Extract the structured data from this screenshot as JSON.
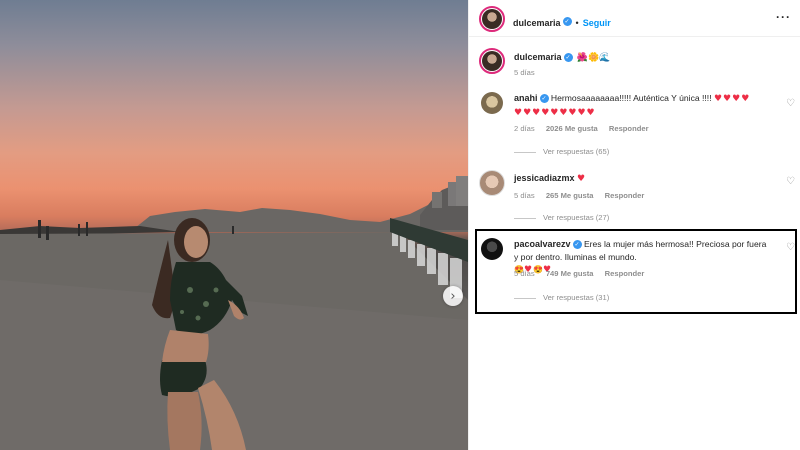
{
  "post": {
    "author": "dulcemaria",
    "follow_label": "Seguir",
    "more_icon": "more-horizontal-icon",
    "caption": "🌺🌼🌊",
    "caption_time": "5 días"
  },
  "comments": [
    {
      "user": "anahi",
      "text_prefix": "Hermosaaaaaaaa!!!!! Auténtica Y única !!!! ",
      "hearts_line1": "♥♥♥♥",
      "hearts_line2": "♥♥♥♥♥♥♥♥♥",
      "time": "2 días",
      "likes": "2026 Me gusta",
      "reply": "Responder",
      "view_replies": "Ver respuestas (65)"
    },
    {
      "user": "jessicadiazmx",
      "hearts": "♥",
      "time": "5 días",
      "likes": "265 Me gusta",
      "reply": "Responder",
      "view_replies": "Ver respuestas (27)"
    },
    {
      "user": "pacoalvarezv",
      "text_line1": "Eres la mujer más hermosa!! Preciosa por fuera",
      "text_line2": "y por dentro. Iluminas el mundo.",
      "emojis": "😍",
      "hearts": "♥",
      "time": "5 días",
      "likes": "749 Me gusta",
      "reply": "Responder",
      "view_replies": "Ver respuestas (31)"
    }
  ],
  "colors": {
    "accent": "#0095f6",
    "verified": "#3897f0",
    "heart": "#ed2e46",
    "muted": "#8e8e8e",
    "highlight_border": "#000000"
  }
}
